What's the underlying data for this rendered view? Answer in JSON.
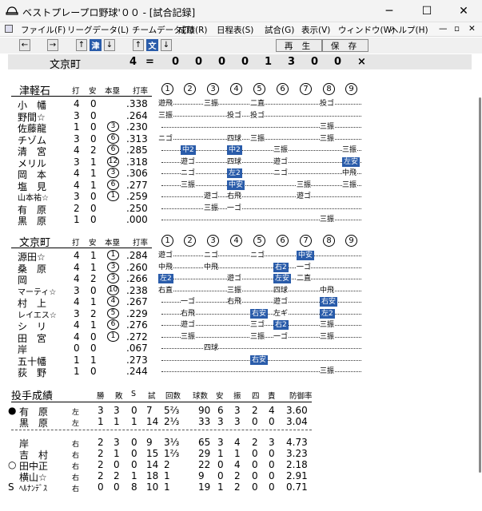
{
  "window": {
    "title": "ベストプレープロ野球'００ - [試合記録]",
    "minimize": "─",
    "maximize": "☐",
    "close": "✕"
  },
  "menu": {
    "items": [
      "ファイル(F)",
      "リーグデータ(L)",
      "チームデータ(T)",
      "成績(R)",
      "日程表(S)",
      "試合(G)",
      "表示(V)",
      "ウィンドウ(W)",
      "ヘルプ(H)"
    ],
    "mdi_min": "—",
    "mdi_restore": "▫",
    "mdi_close": "✕"
  },
  "toolbar": {
    "team_away": "津",
    "team_home": "文",
    "replay": "再 生",
    "save": "保 存",
    "left": "←",
    "right": "→",
    "up": "↑",
    "down": "↓"
  },
  "scorebar": {
    "team": "文京町",
    "total": "4",
    "eq": "=",
    "innings": [
      "0",
      "0",
      "0",
      "0",
      "1",
      "3",
      "0",
      "0",
      "×"
    ]
  },
  "inning_labels": [
    "1",
    "2",
    "3",
    "4",
    "5",
    "6",
    "7",
    "8",
    "9"
  ],
  "headers": {
    "pa": "打",
    "hit": "安",
    "hr": "本塁",
    "avg": "打率"
  },
  "away": {
    "team": "津軽石",
    "players": [
      {
        "name": "小　幡",
        "pa": "4",
        "h": "0",
        "hr": "",
        "avg": ".338"
      },
      {
        "name": "野間☆",
        "pa": "3",
        "h": "0",
        "hr": "",
        "avg": ".264"
      },
      {
        "name": "佐藤龍",
        "pa": "1",
        "h": "0",
        "hr": "3",
        "avg": ".230"
      },
      {
        "name": "チゾム",
        "pa": "3",
        "h": "0",
        "hr": "6",
        "avg": ".313"
      },
      {
        "name": "清　宮",
        "pa": "4",
        "h": "2",
        "hr": "6",
        "avg": ".285"
      },
      {
        "name": "メリル",
        "pa": "3",
        "h": "1",
        "hr": "12",
        "avg": ".318"
      },
      {
        "name": "岡　本",
        "pa": "4",
        "h": "1",
        "hr": "3",
        "avg": ".306"
      },
      {
        "name": "塩　見",
        "pa": "4",
        "h": "1",
        "hr": "6",
        "avg": ".277"
      },
      {
        "name": "山本祐☆",
        "pa": "3",
        "h": "0",
        "hr": "1",
        "avg": ".259"
      },
      {
        "name": "有　原",
        "pa": "2",
        "h": "0",
        "hr": "",
        "avg": ".250"
      },
      {
        "name": "黒　原",
        "pa": "1",
        "h": "0",
        "hr": "",
        "avg": ".000"
      }
    ],
    "cells": [
      [
        [
          0,
          "遊飛",
          0
        ],
        [
          2,
          "三振",
          0
        ],
        [
          4,
          "二直",
          0
        ],
        [
          7,
          "投ゴ",
          0
        ]
      ],
      [
        [
          0,
          "三振",
          0
        ],
        [
          3,
          "投ゴ",
          0
        ],
        [
          4,
          "投ゴ",
          0
        ]
      ],
      [
        [
          7,
          "三振",
          0
        ]
      ],
      [
        [
          0,
          "ニゴ",
          0
        ],
        [
          3,
          "四球",
          0
        ],
        [
          4,
          "三振",
          0
        ],
        [
          7,
          "三振",
          0
        ]
      ],
      [
        [
          1,
          "中2",
          1
        ],
        [
          3,
          "中2",
          1
        ],
        [
          5,
          "三振",
          0
        ],
        [
          8,
          "三振",
          0
        ]
      ],
      [
        [
          1,
          "遊ゴ",
          0
        ],
        [
          3,
          "四球",
          0
        ],
        [
          5,
          "遊ゴ",
          0
        ],
        [
          8,
          "左安",
          1
        ]
      ],
      [
        [
          1,
          "ニゴ",
          0
        ],
        [
          3,
          "左2",
          1
        ],
        [
          5,
          "ニゴ",
          0
        ],
        [
          8,
          "中飛",
          0
        ]
      ],
      [
        [
          1,
          "三振",
          0
        ],
        [
          3,
          "中安",
          1
        ],
        [
          6,
          "三振",
          0
        ],
        [
          8,
          "三振",
          0
        ]
      ],
      [
        [
          2,
          "遊ゴ",
          0
        ],
        [
          3,
          "右飛",
          0
        ],
        [
          6,
          "遊ゴ",
          0
        ]
      ],
      [
        [
          2,
          "三振",
          0
        ],
        [
          3,
          "一ゴ",
          0
        ]
      ],
      [
        [
          7,
          "三振",
          0
        ]
      ]
    ]
  },
  "home": {
    "team": "文京町",
    "players": [
      {
        "name": "源田☆",
        "pa": "4",
        "h": "1",
        "hr": "1",
        "avg": ".284"
      },
      {
        "name": "桑　原",
        "pa": "4",
        "h": "1",
        "hr": "3",
        "avg": ".260"
      },
      {
        "name": "岡",
        "pa": "4",
        "h": "2",
        "hr": "3",
        "avg": ".266"
      },
      {
        "name": "マーティ☆",
        "pa": "3",
        "h": "0",
        "hr": "10",
        "avg": ".238"
      },
      {
        "name": "村　上",
        "pa": "4",
        "h": "1",
        "hr": "4",
        "avg": ".267"
      },
      {
        "name": "レイエス☆",
        "pa": "3",
        "h": "2",
        "hr": "5",
        "avg": ".229"
      },
      {
        "name": "シ　リ",
        "pa": "4",
        "h": "1",
        "hr": "6",
        "avg": ".276"
      },
      {
        "name": "田　宮",
        "pa": "4",
        "h": "0",
        "hr": "1",
        "avg": ".272"
      },
      {
        "name": "岸",
        "pa": "0",
        "h": "0",
        "hr": "",
        "avg": ".067"
      },
      {
        "name": "五十幡",
        "pa": "1",
        "h": "1",
        "hr": "",
        "avg": ".273"
      },
      {
        "name": "荻　野",
        "pa": "1",
        "h": "0",
        "hr": "",
        "avg": ".244"
      }
    ],
    "cells": [
      [
        [
          0,
          "遊ゴ",
          0
        ],
        [
          2,
          "ニゴ",
          0
        ],
        [
          4,
          "ニゴ",
          0
        ],
        [
          6,
          "中安",
          1
        ]
      ],
      [
        [
          0,
          "中飛",
          0
        ],
        [
          2,
          "中飛",
          0
        ],
        [
          5,
          "右2",
          1
        ],
        [
          6,
          "一ゴ",
          0
        ]
      ],
      [
        [
          0,
          "左2",
          1
        ],
        [
          3,
          "遊ゴ",
          0
        ],
        [
          5,
          "左安",
          1
        ],
        [
          6,
          "二直",
          0
        ]
      ],
      [
        [
          0,
          "右直",
          0
        ],
        [
          3,
          "三振",
          0
        ],
        [
          5,
          "四球",
          0
        ],
        [
          7,
          "中飛",
          0
        ]
      ],
      [
        [
          1,
          "一ゴ",
          0
        ],
        [
          3,
          "右飛",
          0
        ],
        [
          5,
          "遊ゴ",
          0
        ],
        [
          7,
          "右安",
          1
        ]
      ],
      [
        [
          1,
          "右飛",
          0
        ],
        [
          4,
          "右安",
          1
        ],
        [
          5,
          "左ギ",
          0
        ],
        [
          7,
          "左2",
          1
        ]
      ],
      [
        [
          1,
          "遊ゴ",
          0
        ],
        [
          4,
          "三ゴ",
          0
        ],
        [
          5,
          "右2",
          1
        ],
        [
          7,
          "三振",
          0
        ]
      ],
      [
        [
          1,
          "三振",
          0
        ],
        [
          4,
          "三振",
          0
        ],
        [
          5,
          "一ゴ",
          0
        ],
        [
          7,
          "三振",
          0
        ]
      ],
      [
        [
          2,
          "四球",
          0
        ]
      ],
      [
        [
          4,
          "右安",
          1
        ]
      ],
      [
        [
          7,
          "三振",
          0
        ]
      ]
    ]
  },
  "pitching": {
    "title": "投手成績",
    "headers": [
      "勝",
      "敗",
      "S",
      "試",
      "回数",
      "球数",
      "安",
      "振",
      "四",
      "責",
      "防御率"
    ],
    "rows": [
      {
        "mark": "●",
        "name": "有　原",
        "hand": "左",
        "w": "3",
        "l": "3",
        "s": "0",
        "g": "7",
        "ip": "5⅔",
        "np": "90",
        "h": "6",
        "k": "3",
        "bb": "2",
        "er": "4",
        "era": "3.60"
      },
      {
        "mark": "",
        "name": "黒　原",
        "hand": "左",
        "w": "1",
        "l": "1",
        "s": "1",
        "g": "14",
        "ip": "2⅓",
        "np": "33",
        "h": "3",
        "k": "3",
        "bb": "0",
        "er": "0",
        "era": "3.04"
      },
      {
        "mark": "",
        "name": "岸",
        "hand": "右",
        "w": "2",
        "l": "3",
        "s": "0",
        "g": "9",
        "ip": "3⅓",
        "np": "65",
        "h": "3",
        "k": "4",
        "bb": "2",
        "er": "3",
        "era": "4.73"
      },
      {
        "mark": "",
        "name": "吉　村",
        "hand": "右",
        "w": "2",
        "l": "1",
        "s": "0",
        "g": "15",
        "ip": "1⅔",
        "np": "29",
        "h": "1",
        "k": "1",
        "bb": "0",
        "er": "0",
        "era": "3.23"
      },
      {
        "mark": "○",
        "name": "田中正",
        "hand": "右",
        "w": "2",
        "l": "0",
        "s": "0",
        "g": "14",
        "ip": "2",
        "np": "22",
        "h": "0",
        "k": "4",
        "bb": "0",
        "er": "0",
        "era": "2.18"
      },
      {
        "mark": "",
        "name": "横山☆",
        "hand": "右",
        "w": "2",
        "l": "2",
        "s": "1",
        "g": "18",
        "ip": "1",
        "np": "9",
        "h": "0",
        "k": "2",
        "bb": "0",
        "er": "0",
        "era": "2.91"
      },
      {
        "mark": "S",
        "name": "ﾍﾙﾅﾝﾃﾞｽ",
        "hand": "右",
        "w": "0",
        "l": "0",
        "s": "8",
        "g": "10",
        "ip": "1",
        "np": "19",
        "h": "1",
        "k": "2",
        "bb": "0",
        "er": "0",
        "era": "0.71"
      }
    ]
  }
}
